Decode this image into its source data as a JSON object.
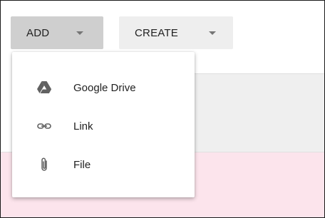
{
  "toolbar": {
    "add_label": "ADD",
    "create_label": "CREATE"
  },
  "add_menu": {
    "items": [
      {
        "label": "Google Drive",
        "icon": "google-drive-icon"
      },
      {
        "label": "Link",
        "icon": "link-icon"
      },
      {
        "label": "File",
        "icon": "paperclip-icon"
      }
    ]
  },
  "colors": {
    "add_button_bg": "#cfcfcf",
    "create_button_bg": "#eeeeee",
    "grey_band": "#efefef",
    "pink_band": "#fce4ec",
    "icon": "#616161"
  }
}
